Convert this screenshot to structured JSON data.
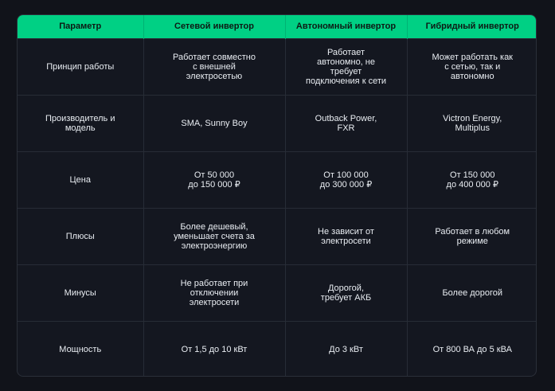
{
  "table": {
    "headers": [
      "Параметр",
      "Сетевой инвертор",
      "Автономный инвертор",
      "Гибридный инвертор"
    ],
    "rows": [
      [
        "Принцип работы",
        "Работает совместно\nс внешней\nэлектросетью",
        "Работает\nавтономно, не\nтребует\nподключения к сети",
        "Может работать как\nс сетью, так и\nавтономно"
      ],
      [
        "Производитель и\nмодель",
        "SMA, Sunny Boy",
        "Outback Power,\nFXR",
        "Victron Energy,\nMultiplus"
      ],
      [
        "Цена",
        "От 50 000\nдо 150 000 ₽",
        "От 100 000\nдо 300 000 ₽",
        "От 150 000\nдо 400 000 ₽"
      ],
      [
        "Плюсы",
        "Более дешевый,\nуменьшает счета за\nэлектроэнергию",
        "Не зависит от\nэлектросети",
        "Работает в любом\nрежиме"
      ],
      [
        "Минусы",
        "Не работает при\nотключении\nэлектросети",
        "Дорогой,\nтребует АКБ",
        "Более дорогой"
      ],
      [
        "Мощность",
        "От 1,5 до 10 кВт",
        "До 3 кВт",
        "От 800 ВА до 5 кВА"
      ]
    ]
  },
  "colors": {
    "header_bg": "#00d084",
    "page_bg": "#11131a",
    "text": "#e9edf2"
  }
}
